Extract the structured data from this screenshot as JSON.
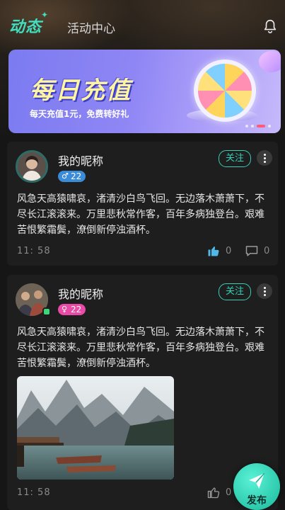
{
  "header": {
    "tab_active": "动态",
    "tab_other": "活动中心"
  },
  "banner": {
    "title": "每日充值",
    "subtitle": "每天充值1元，免费转好礼"
  },
  "posts": [
    {
      "nickname": "我的昵称",
      "gender_symbol": "♂",
      "age": "22",
      "follow_label": "关注",
      "content": "风急天高猿啸哀，渚清沙白鸟飞回。无边落木萧萧下，不尽长江滚滚来。万里悲秋常作客，百年多病独登台。艰难苦恨繁霜鬓，潦倒新停浊酒杯。",
      "time": "11: 58",
      "likes": "0",
      "comments": "0"
    },
    {
      "nickname": "我的昵称",
      "gender_symbol": "♀",
      "age": "22",
      "follow_label": "关注",
      "content": "风急天高猿啸哀，渚清沙白鸟飞回。无边落木萧萧下，不尽长江滚滚来。万里悲秋常作客，百年多病独登台。艰难苦恨繁霜鬓，潦倒新停浊酒杯。",
      "time": "11: 58",
      "likes": "0"
    }
  ],
  "fab": {
    "label": "发布"
  },
  "colors": {
    "accent": "#36d0b8",
    "male": "#3a8bd8",
    "female": "#e84aa6"
  }
}
